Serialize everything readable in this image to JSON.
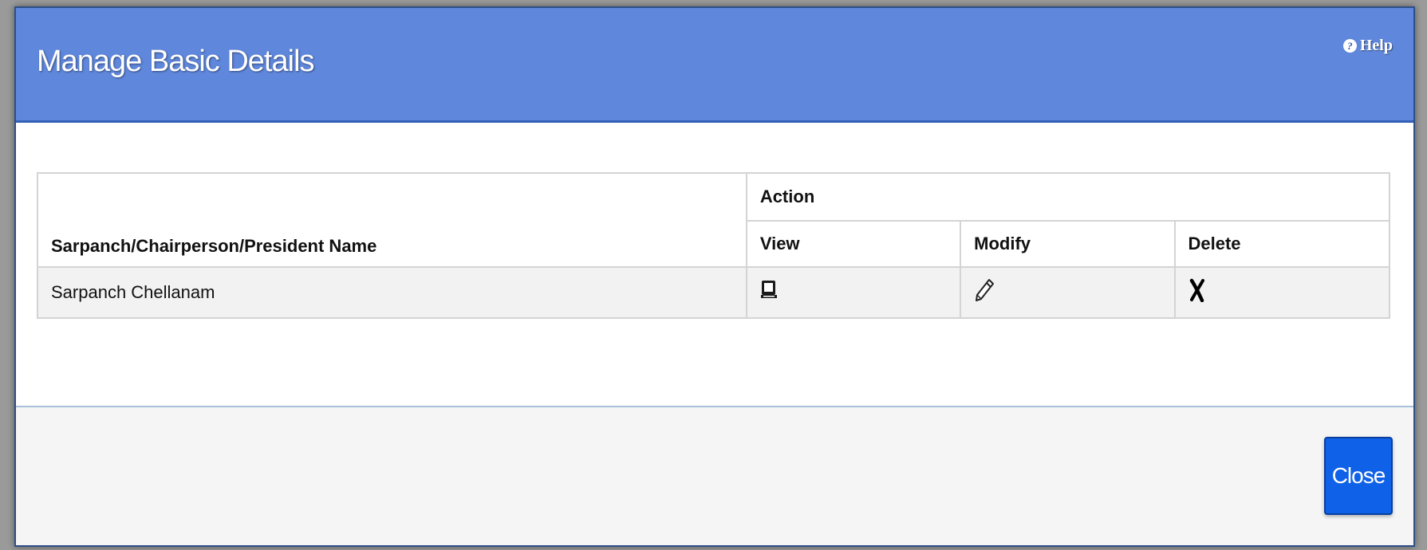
{
  "dialog": {
    "title": "Manage Basic Details",
    "help_label": "Help",
    "help_icon_glyph": "?"
  },
  "table": {
    "name_header": "Sarpanch/Chairperson/President Name",
    "action_header": "Action",
    "view_header": "View",
    "modify_header": "Modify",
    "delete_header": "Delete",
    "rows": [
      {
        "name": "Sarpanch Chellanam",
        "view_icon": "view-icon",
        "modify_icon": "pencil-icon",
        "delete_icon": "cross-icon"
      }
    ]
  },
  "footer": {
    "close_label": "Close"
  },
  "colors": {
    "header_bg": "#5f87db",
    "close_button_bg": "#0f61e8"
  }
}
